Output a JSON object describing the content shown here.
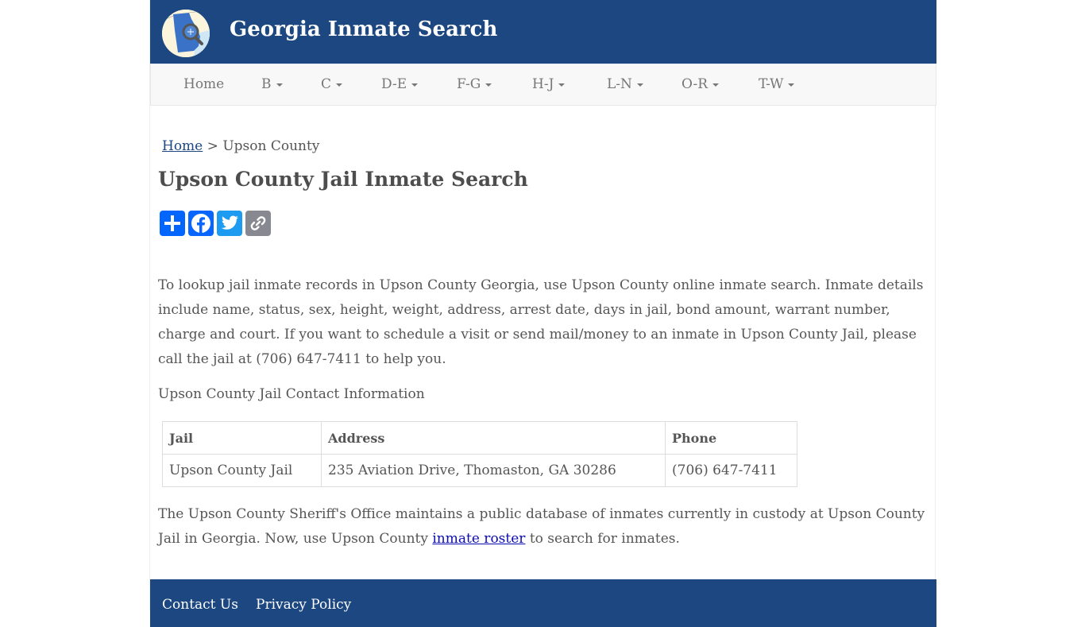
{
  "header": {
    "site_title": "Georgia Inmate Search",
    "logo_icon": "georgia-map-magnifier-icon",
    "brand_color": "#1c4780"
  },
  "nav": {
    "items": [
      {
        "label": "Home",
        "dropdown": false
      },
      {
        "label": "B",
        "dropdown": true
      },
      {
        "label": "C",
        "dropdown": true
      },
      {
        "label": "D-E",
        "dropdown": true
      },
      {
        "label": "F-G",
        "dropdown": true
      },
      {
        "label": "H-J",
        "dropdown": true
      },
      {
        "label": "L-N",
        "dropdown": true
      },
      {
        "label": "O-R",
        "dropdown": true
      },
      {
        "label": "T-W",
        "dropdown": true
      }
    ]
  },
  "breadcrumb": {
    "home": "Home",
    "separator": ">",
    "current": "Upson County"
  },
  "page": {
    "title": "Upson County Jail Inmate Search",
    "share_buttons": [
      {
        "name": "share",
        "icon": "plus-icon",
        "color": "#0166ff"
      },
      {
        "name": "facebook",
        "icon": "facebook-icon",
        "color": "#0866ff"
      },
      {
        "name": "twitter",
        "icon": "twitter-icon",
        "color": "#1d9bf0"
      },
      {
        "name": "copy-link",
        "icon": "link-icon",
        "color": "#888990"
      }
    ],
    "intro": "To lookup jail inmate records in Upson County Georgia, use Upson County online inmate search. Inmate details include name, status, sex, height, weight, address, arrest date, days in jail, bond amount, warrant number, charge and court. If you want to schedule a visit or send mail/money to an inmate in Upson County Jail, please call the jail at (706) 647-7411 to help you.",
    "contact_heading": "Upson County Jail Contact Information",
    "table": {
      "headers": [
        "Jail",
        "Address",
        "Phone"
      ],
      "rows": [
        [
          "Upson County Jail",
          "235 Aviation Drive, Thomaston, GA 30286",
          "(706) 647-7411"
        ]
      ]
    },
    "closing_before": "The Upson County Sheriff's Office maintains a public database of inmates currently in custody at Upson County Jail in Georgia. Now, use Upson County ",
    "closing_link": "inmate roster",
    "closing_after": " to search for inmates."
  },
  "footer": {
    "links": [
      "Contact Us",
      "Privacy Policy"
    ]
  }
}
